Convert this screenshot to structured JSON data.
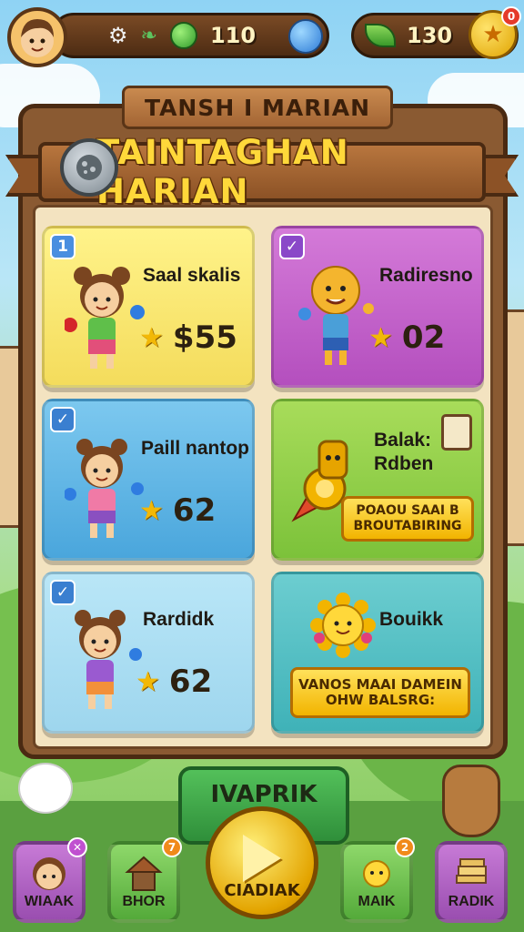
{
  "header": {
    "settings_icon": "gear-icon",
    "feather_icon": "feather-icon",
    "gem_value": "110",
    "leaf_value": "130",
    "notification_count": "0"
  },
  "board": {
    "sign_title": "TANSH I MARIAN",
    "banner_title": "TAINTAGHAN HARIAN"
  },
  "tasks": [
    {
      "label": "Saal skalis",
      "reward": "55",
      "reward_prefix": "$",
      "checked": "1"
    },
    {
      "label": "Radiresno",
      "reward": "02"
    },
    {
      "label": "Paill nantop",
      "reward": "62"
    },
    {
      "label": "Balak: Rdben",
      "label_line1": "Balak:",
      "label_line2": "Rdben",
      "button": "POAOU SAAI B BROUTABIRING"
    },
    {
      "label": "Rardidk",
      "reward": "62"
    },
    {
      "label": "Bouikk",
      "button": "VANOS MAAI DAMEIN OHW BALSRG:"
    }
  ],
  "claim_panel": {
    "title": "IVAPRIK",
    "button_label": "CIADIAK"
  },
  "bottom_nav": [
    {
      "label": "WIAAK",
      "badge": ""
    },
    {
      "label": "BHOR",
      "badge": "7"
    },
    {
      "label": "MAIK",
      "badge": "2"
    },
    {
      "label": "RADIK",
      "badge": ""
    }
  ]
}
